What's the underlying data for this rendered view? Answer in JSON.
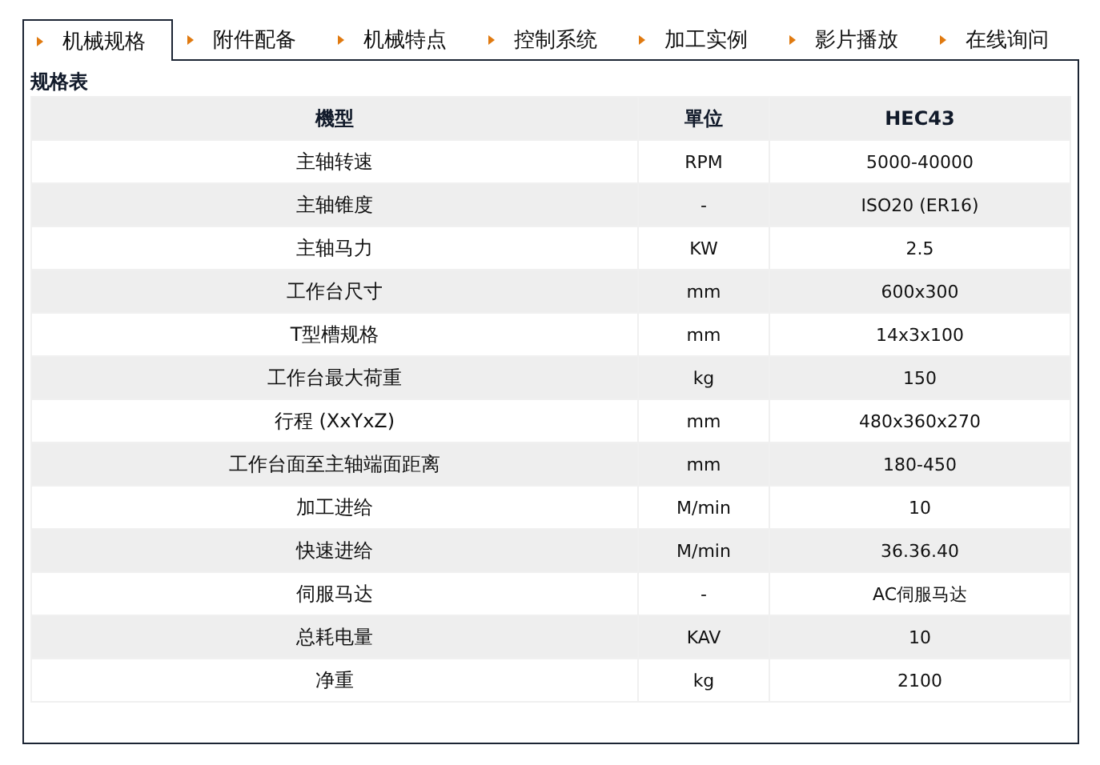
{
  "tabs": [
    {
      "label": "机械规格",
      "selected": true
    },
    {
      "label": "附件配备",
      "selected": false
    },
    {
      "label": "机械特点",
      "selected": false
    },
    {
      "label": "控制系统",
      "selected": false
    },
    {
      "label": "加工实例",
      "selected": false
    },
    {
      "label": "影片播放",
      "selected": false
    },
    {
      "label": "在线询问",
      "selected": false
    }
  ],
  "section_title": "规格表",
  "table": {
    "columns": [
      "機型",
      "單位",
      "HEC43"
    ],
    "rows": [
      [
        "主轴转速",
        "RPM",
        "5000-40000"
      ],
      [
        "主轴锥度",
        "-",
        "ISO20 (ER16)"
      ],
      [
        "主轴马力",
        "KW",
        "2.5"
      ],
      [
        "工作台尺寸",
        "mm",
        "600x300"
      ],
      [
        "T型槽规格",
        "mm",
        "14x3x100"
      ],
      [
        "工作台最大荷重",
        "kg",
        "150"
      ],
      [
        "行程 (XxYxZ)",
        "mm",
        "480x360x270"
      ],
      [
        "工作台面至主轴端面距离",
        "mm",
        "180-450"
      ],
      [
        "加工进给",
        "M/min",
        "10"
      ],
      [
        "快速进给",
        "M/min",
        "36.36.40"
      ],
      [
        "伺服马达",
        "-",
        "AC伺服马达"
      ],
      [
        "总耗电量",
        "KAV",
        "10"
      ],
      [
        "净重",
        "kg",
        "2100"
      ]
    ]
  }
}
